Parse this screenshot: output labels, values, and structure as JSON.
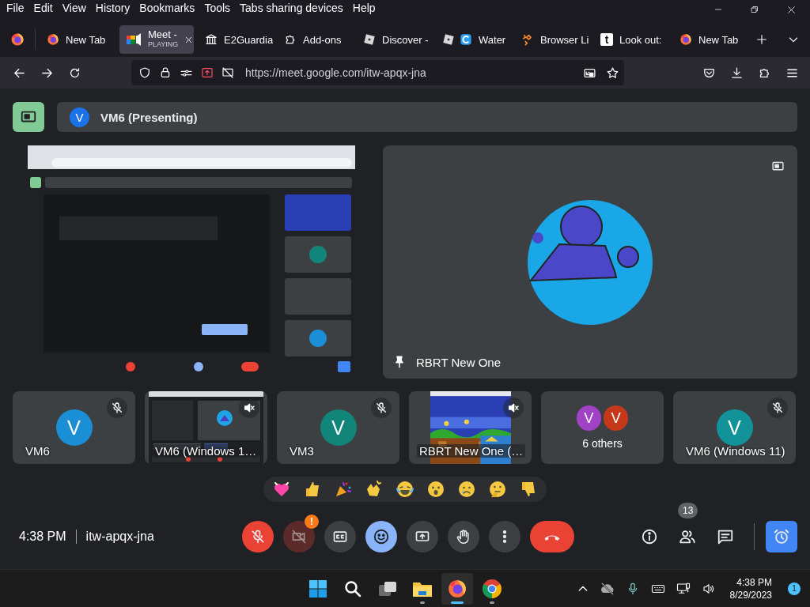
{
  "menu_bar": [
    "File",
    "Edit",
    "View",
    "History",
    "Bookmarks",
    "Tools",
    "Tabs sharing devices",
    "Help"
  ],
  "tabs": [
    {
      "kind": "firefox",
      "title": "New Tab",
      "selected": false
    },
    {
      "kind": "meet",
      "title": "Meet -",
      "subtitle": "PLAYING",
      "selected": true
    },
    {
      "kind": "building",
      "title": "E2Guardia",
      "selected": false
    },
    {
      "kind": "puzzle",
      "title": "Add-ons",
      "selected": false
    },
    {
      "kind": "cube",
      "title": "Discover -",
      "selected": false
    },
    {
      "kind": "cube-wave",
      "title": "Water",
      "selected": false
    },
    {
      "kind": "sparkle",
      "title": "Browser Li",
      "selected": false
    },
    {
      "kind": "letter",
      "letter": "t",
      "title": "Look out:",
      "selected": false
    },
    {
      "kind": "firefox",
      "title": "New Tab",
      "selected": false
    }
  ],
  "address_bar": {
    "url": "https://meet.google.com/itw-apqx-jna"
  },
  "meet": {
    "presenter_bar": {
      "avatar": "V",
      "name": "VM6 (Presenting)"
    },
    "pinned_tile": {
      "name": "RBRT New One",
      "pinned": true,
      "presenting": true
    },
    "tiles": [
      {
        "kind": "avatar",
        "name": "VM6",
        "avatar": "V",
        "color": "#1a8fd6",
        "muted": true
      },
      {
        "kind": "video",
        "name": "VM6 (Windows 1…",
        "muted": true
      },
      {
        "kind": "avatar",
        "name": "VM3",
        "avatar": "V",
        "color": "#12857a",
        "muted": true
      },
      {
        "kind": "video",
        "name": "RBRT New One (…",
        "muted": true
      },
      {
        "kind": "group",
        "name": "6 others",
        "avatars": [
          {
            "letter": "V",
            "color": "#a142c4"
          },
          {
            "letter": "V",
            "color": "#c5391a"
          }
        ],
        "muted": false
      },
      {
        "kind": "avatar",
        "name": "VM6 (Windows 11)",
        "avatar": "V",
        "color": "#12939a",
        "muted": true
      }
    ],
    "controls": {
      "time": "4:38 PM",
      "meeting_code": "itw-apqx-jna",
      "mic_on": false,
      "camera_on": false,
      "camera_alert": "!",
      "captions_on": false,
      "reactions_on": true,
      "people_count": "13"
    }
  },
  "taskbar": {
    "apps": [
      {
        "kind": "start",
        "running": false,
        "selected": false
      },
      {
        "kind": "search",
        "running": false,
        "selected": false
      },
      {
        "kind": "task-view",
        "running": false,
        "selected": false
      },
      {
        "kind": "files",
        "running": true,
        "selected": false
      },
      {
        "kind": "firefox",
        "running": true,
        "selected": true
      },
      {
        "kind": "chrome",
        "running": true,
        "selected": false
      }
    ],
    "time": "4:38 PM",
    "date": "8/29/2023",
    "notifications": "1"
  }
}
